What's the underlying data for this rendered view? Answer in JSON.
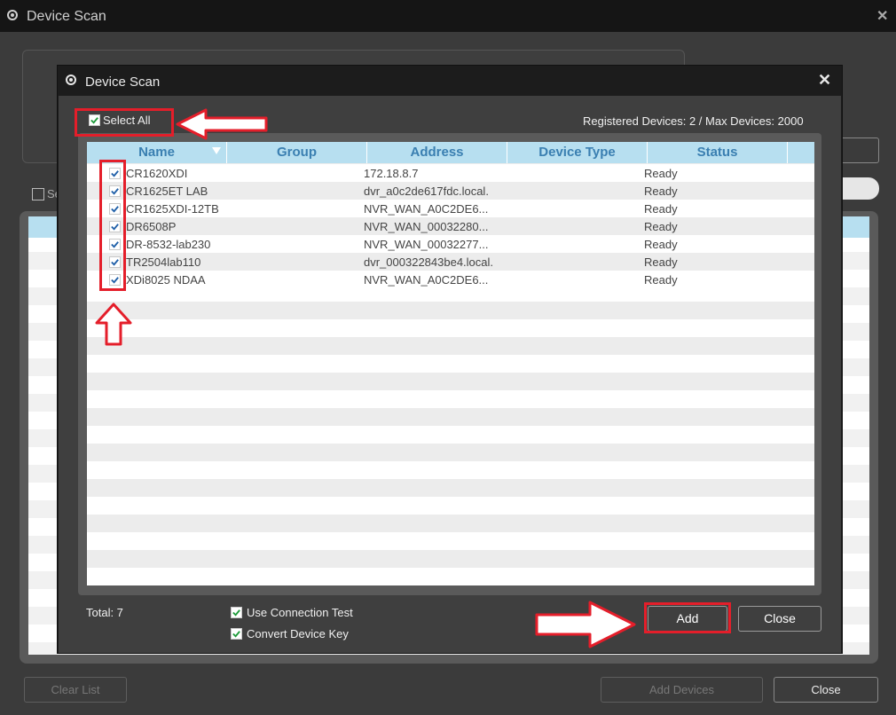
{
  "background_window": {
    "title": "Device Scan",
    "select_label": "Se",
    "buttons": {
      "clear_list": "Clear List",
      "add_devices": "Add Devices",
      "close": "Close"
    }
  },
  "dialog": {
    "title": "Device Scan",
    "select_all_label": "Select All",
    "registered_text": "Registered Devices: 2 / Max Devices: 2000",
    "columns": [
      "Name",
      "Group",
      "Address",
      "Device Type",
      "Status"
    ],
    "devices": [
      {
        "name": "CR1620XDI",
        "group": "",
        "address": "172.18.8.7",
        "device_type": "",
        "status": "Ready"
      },
      {
        "name": "CR1625ET LAB",
        "group": "",
        "address": "dvr_a0c2de617fdc.local.",
        "device_type": "",
        "status": "Ready"
      },
      {
        "name": "CR1625XDI-12TB",
        "group": "",
        "address": "NVR_WAN_A0C2DE6...",
        "device_type": "",
        "status": "Ready"
      },
      {
        "name": "DR6508P",
        "group": "",
        "address": "NVR_WAN_00032280...",
        "device_type": "",
        "status": "Ready"
      },
      {
        "name": "DR-8532-lab230",
        "group": "",
        "address": "NVR_WAN_00032277...",
        "device_type": "",
        "status": "Ready"
      },
      {
        "name": "TR2504lab110",
        "group": "",
        "address": "dvr_000322843be4.local.",
        "device_type": "",
        "status": "Ready"
      },
      {
        "name": "XDi8025 NDAA",
        "group": "",
        "address": "NVR_WAN_A0C2DE6...",
        "device_type": "",
        "status": "Ready"
      }
    ],
    "total_label": "Total: 7",
    "options": {
      "use_connection_test": "Use Connection Test",
      "convert_device_key": "Convert Device Key"
    },
    "buttons": {
      "add": "Add",
      "close": "Close"
    }
  },
  "colors": {
    "accent_blue": "#3a7fb1",
    "header_bg": "#b7dff0",
    "annotation_red": "#e41e2a"
  }
}
